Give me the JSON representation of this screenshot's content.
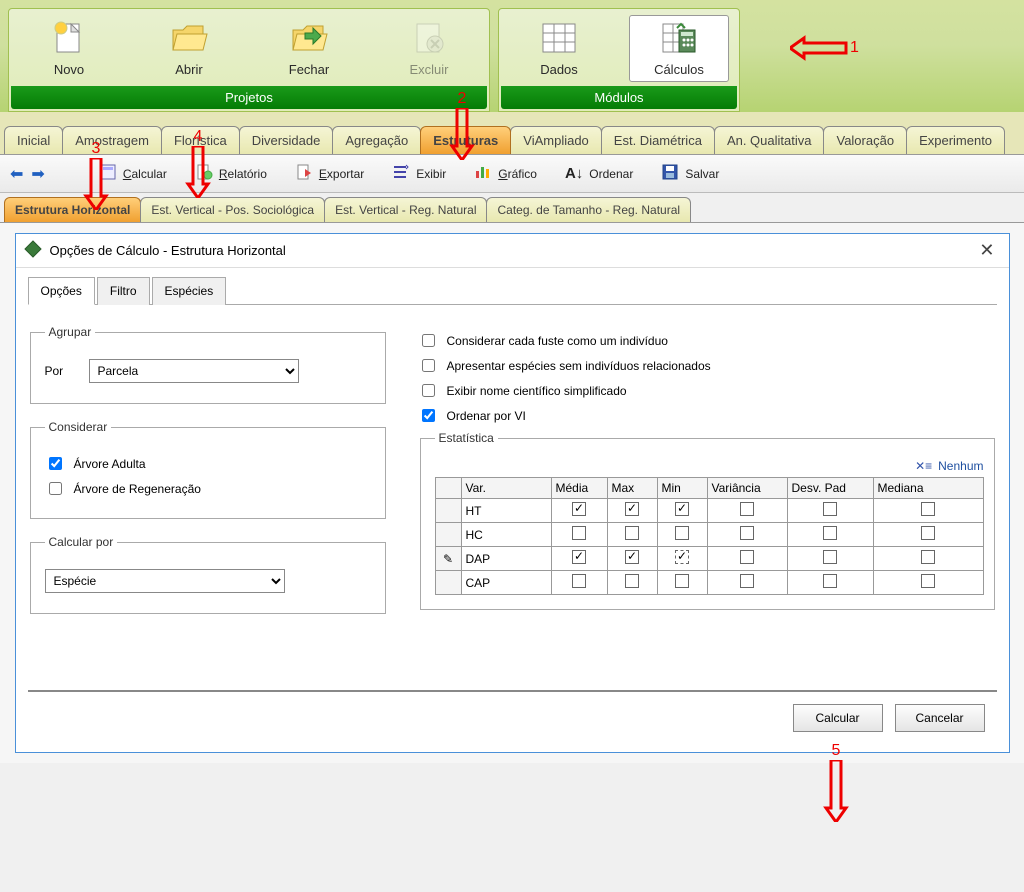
{
  "ribbon": {
    "groups": [
      {
        "title": "Projetos",
        "items": [
          {
            "label": "Novo",
            "icon": "new"
          },
          {
            "label": "Abrir",
            "icon": "open"
          },
          {
            "label": "Fechar",
            "icon": "close"
          },
          {
            "label": "Excluir",
            "icon": "delete",
            "disabled": true
          }
        ]
      },
      {
        "title": "Módulos",
        "items": [
          {
            "label": "Dados",
            "icon": "grid"
          },
          {
            "label": "Cálculos",
            "icon": "calc",
            "active": true
          }
        ]
      }
    ]
  },
  "mainTabs": [
    "Inicial",
    "Amostragem",
    "Florística",
    "Diversidade",
    "Agregação",
    "Estruturas",
    "ViAmpliado",
    "Est. Diamétrica",
    "An. Qualitativa",
    "Valoração",
    "Experimento"
  ],
  "mainTabActive": 5,
  "toolbar": {
    "calcular": "Calcular",
    "relatorio": "Relatório",
    "exportar": "Exportar",
    "exibir": "Exibir",
    "grafico": "Gráfico",
    "ordenar": "Ordenar",
    "salvar": "Salvar"
  },
  "subTabs": [
    "Estrutura Horizontal",
    "Est. Vertical - Pos. Sociológica",
    "Est. Vertical - Reg. Natural",
    "Categ. de Tamanho - Reg. Natural"
  ],
  "subTabActive": 0,
  "dialog": {
    "title": "Opções de Cálculo - Estrutura Horizontal",
    "tabs": [
      "Opções",
      "Filtro",
      "Espécies"
    ],
    "tabActive": 0,
    "agrupar": {
      "legend": "Agrupar",
      "porLabel": "Por",
      "porValue": "Parcela"
    },
    "considerar": {
      "legend": "Considerar",
      "items": [
        {
          "label": "Árvore Adulta",
          "checked": true
        },
        {
          "label": "Árvore de Regeneração",
          "checked": false
        }
      ]
    },
    "calcularPor": {
      "legend": "Calcular por",
      "value": "Espécie"
    },
    "opts": [
      {
        "label": "Considerar cada fuste como um indivíduo",
        "checked": false
      },
      {
        "label": "Apresentar espécies sem indivíduos relacionados",
        "checked": false
      },
      {
        "label": "Exibir nome científico simplificado",
        "checked": false
      },
      {
        "label": "Ordenar por VI",
        "checked": true
      }
    ],
    "estatistica": {
      "legend": "Estatística",
      "nenhum": "Nenhum",
      "headers": [
        "Var.",
        "Média",
        "Max",
        "Min",
        "Variância",
        "Desv. Pad",
        "Mediana"
      ],
      "rows": [
        {
          "var": "HT",
          "media": true,
          "max": true,
          "min": true,
          "variancia": false,
          "desvpad": false,
          "mediana": false,
          "edit": false
        },
        {
          "var": "HC",
          "media": false,
          "max": false,
          "min": false,
          "variancia": false,
          "desvpad": false,
          "mediana": false,
          "edit": false
        },
        {
          "var": "DAP",
          "media": true,
          "max": true,
          "min": true,
          "variancia": false,
          "desvpad": false,
          "mediana": false,
          "edit": true,
          "minDotted": true
        },
        {
          "var": "CAP",
          "media": false,
          "max": false,
          "min": false,
          "variancia": false,
          "desvpad": false,
          "mediana": false,
          "edit": false
        }
      ]
    },
    "buttons": {
      "calcular": "Calcular",
      "cancelar": "Cancelar"
    }
  },
  "annotations": {
    "1": "1",
    "2": "2",
    "3": "3",
    "4": "4",
    "5": "5"
  }
}
